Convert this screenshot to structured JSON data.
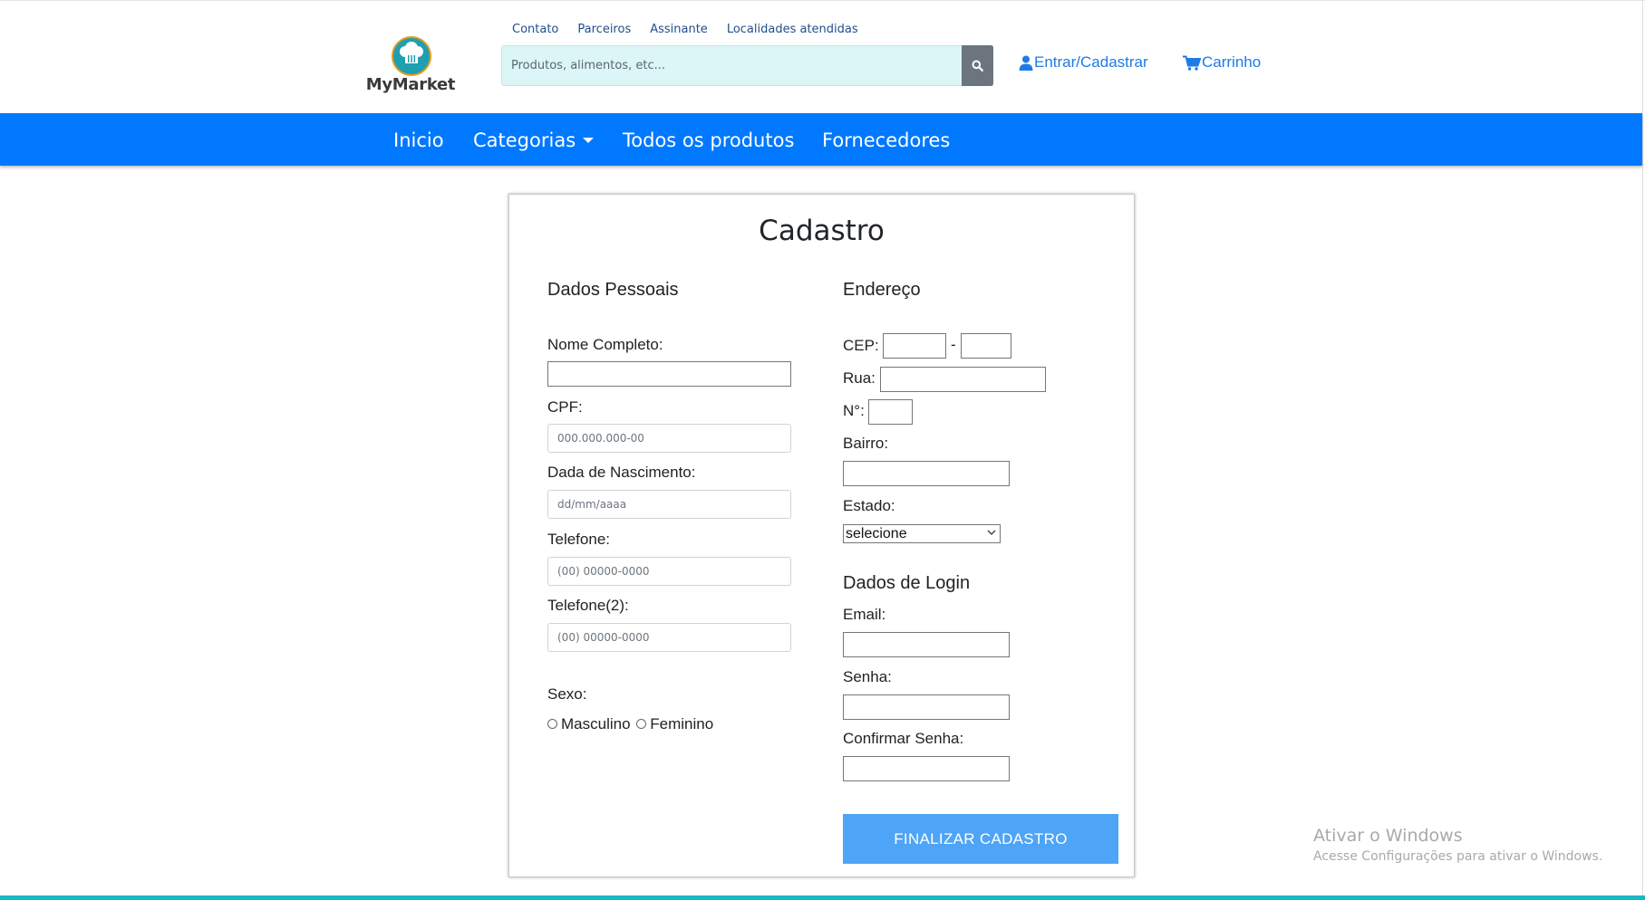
{
  "header": {
    "brand": "MyMarket",
    "top_links": [
      "Contato",
      "Parceiros",
      "Assinante",
      "Localidades atendidas"
    ],
    "search_placeholder": "Produtos, alimentos, etc...",
    "search_icon": "search-icon",
    "login_label": "Entrar/Cadastrar",
    "cart_label": "Carrinho",
    "accent_color": "#1e7be6"
  },
  "nav": {
    "items": [
      "Inicio",
      "Categorias",
      "Todos os produtos",
      "Fornecedores"
    ],
    "background": "#0078ff"
  },
  "form": {
    "title": "Cadastro",
    "personal": {
      "heading": "Dados Pessoais",
      "nome_label": "Nome Completo:",
      "cpf_label": "CPF:",
      "cpf_placeholder": "000.000.000-00",
      "nascimento_label": "Dada de Nascimento:",
      "nascimento_placeholder": "dd/mm/aaaa",
      "telefone_label": "Telefone:",
      "telefone_placeholder": "(00) 00000-0000",
      "telefone2_label": "Telefone(2):",
      "telefone2_placeholder": "(00) 00000-0000",
      "sexo_label": "Sexo:",
      "sexo_options": [
        "Masculino",
        "Feminino"
      ]
    },
    "address": {
      "heading": "Endereço",
      "cep_label": "CEP:",
      "cep_separator": "-",
      "rua_label": "Rua:",
      "numero_label": "N°:",
      "bairro_label": "Bairro:",
      "estado_label": "Estado:",
      "estado_selected": "selecione"
    },
    "login": {
      "heading": "Dados de Login",
      "email_label": "Email:",
      "senha_label": "Senha:",
      "confirmar_label": "Confirmar Senha:"
    },
    "submit_label": "FINALIZAR CADASTRO",
    "submit_color": "#4ea4f6"
  },
  "watermark": {
    "line1": "Ativar o Windows",
    "line2": "Acesse Configurações para ativar o Windows."
  }
}
